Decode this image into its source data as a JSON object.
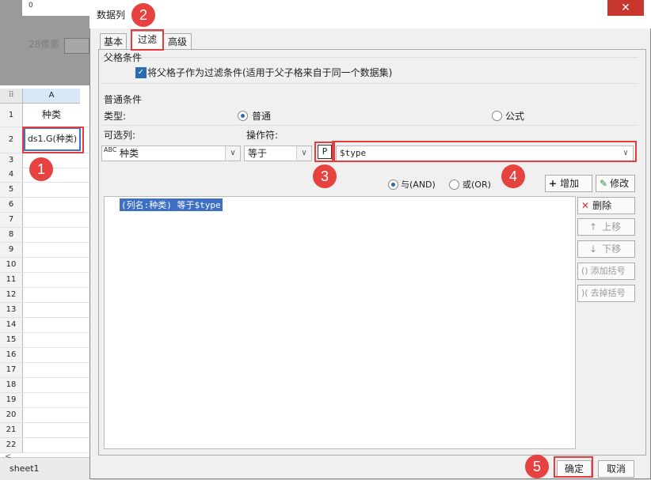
{
  "sheet": {
    "ruler_zero": "0",
    "px_label": "28像素",
    "corner": "⠿",
    "col_a": "A",
    "cell_a1": "种类",
    "cell_a2": "ds1.G(种类)",
    "row_numbers": [
      "1",
      "2",
      "3",
      "4",
      "5",
      "6",
      "7",
      "8",
      "9",
      "10",
      "11",
      "12",
      "13",
      "14",
      "15",
      "16",
      "17",
      "18",
      "19",
      "20",
      "21",
      "22"
    ],
    "sheet_tab": "sheet1",
    "scroll_left": "<"
  },
  "dialog": {
    "title": "数据列",
    "close": "✕",
    "tabs": [
      "基本",
      "过滤",
      "高级"
    ],
    "parent_group": "父格条件",
    "parent_checkbox": "将父格子作为过滤条件(适用于父子格来自于同一个数据集)",
    "normal_group": "普通条件",
    "type_label": "类型:",
    "type_normal": "普通",
    "type_formula": "公式",
    "column_label": "可选列:",
    "column_value": "种类",
    "operator_label": "操作符:",
    "operator_value": "等于",
    "param_button": "P",
    "value_input": "$type",
    "and_label": "与(AND)",
    "or_label": "或(OR)",
    "add_button": "增加",
    "edit_button": "修改",
    "condition_item": "(列名:种类) 等于$type",
    "delete_button": "删除",
    "move_up_button": "上移",
    "move_down_button": "下移",
    "add_bracket_button": "添加括号",
    "remove_bracket_button": "去掉括号",
    "ok_button": "确定",
    "cancel_button": "取消"
  },
  "annotations": [
    "1",
    "2",
    "3",
    "4",
    "5"
  ],
  "colors": {
    "annotation_red": "#e6423f",
    "selection_blue": "#3d6fc4"
  }
}
